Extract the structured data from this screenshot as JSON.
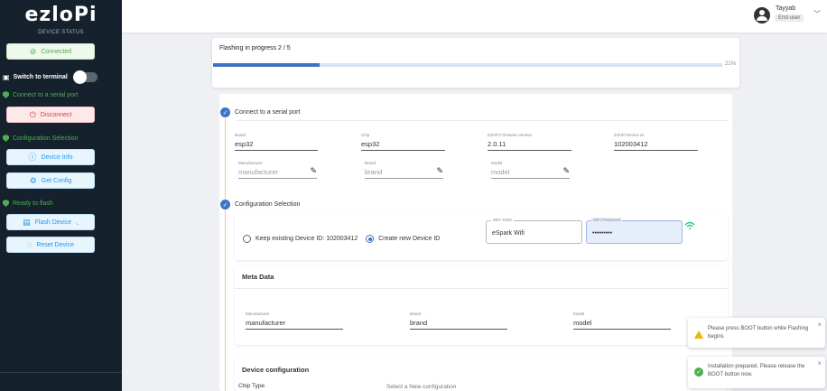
{
  "sidebar": {
    "logo": "ezloPi",
    "device_status": "DEVICE STATUS",
    "connected_label": "Connected",
    "switch_terminal_label": "Switch to terminal",
    "connect_serial_label": "Connect to a serial port",
    "disconnect_label": "Disconnect",
    "config_selection_label": "Configuration Selection",
    "device_info_label": "Device Info",
    "get_config_label": "Get Config",
    "ready_flash_label": "Ready to flash",
    "flash_device_label": "Flash Device",
    "reset_device_label": "Reset Device"
  },
  "header": {
    "username": "Tayyab",
    "role": "End-user"
  },
  "progress": {
    "title": "Flashing in progress 2 / 5",
    "percent_label": "21%",
    "percent": 21
  },
  "serial_step": {
    "title": "Connect to a serial port",
    "board_label": "Board",
    "board_value": "esp32",
    "chip_label": "Chip",
    "chip_value": "esp32",
    "firmware_label": "EzloPi Firmware Version",
    "firmware_value": "2.0.11",
    "device_id_label": "EzloPi Device Id",
    "device_id_value": "102003412",
    "manufacturer_label": "Manufacturer",
    "manufacturer_value": "manufacturer",
    "brand_label": "Brand",
    "brand_value": "brand",
    "model_label": "Model",
    "model_value": "model"
  },
  "config_step": {
    "title": "Configuration Selection",
    "radio_keep": "Keep existing Device ID: 102003412",
    "radio_create": "Create new Device ID",
    "selected": "create",
    "wifi_ssid_label": "WiFi SSID",
    "wifi_ssid_value": "eSpark Wifi",
    "wifi_password_label": "WiFi Password",
    "wifi_password_value": "•••••••••"
  },
  "meta": {
    "title": "Meta Data",
    "manufacturer_label": "Manufacturer",
    "manufacturer_value": "manufacturer",
    "brand_label": "Brand",
    "brand_value": "brand",
    "model_label": "Model",
    "model_value": "model"
  },
  "device_config": {
    "title": "Device configuration",
    "chip_type_label": "Chip Type",
    "select_label": "Select a New configuration"
  },
  "toasts": [
    {
      "type": "warning",
      "message": "Please press BOOT button while Flashing begins"
    },
    {
      "type": "success",
      "message": "Installation prepared. Please release the BOOT button now."
    }
  ],
  "colors": {
    "sidebar_bg": "#15212d",
    "accent": "#3f72c5",
    "success": "#4caf50",
    "danger": "#e53935",
    "info": "#2196f3"
  }
}
